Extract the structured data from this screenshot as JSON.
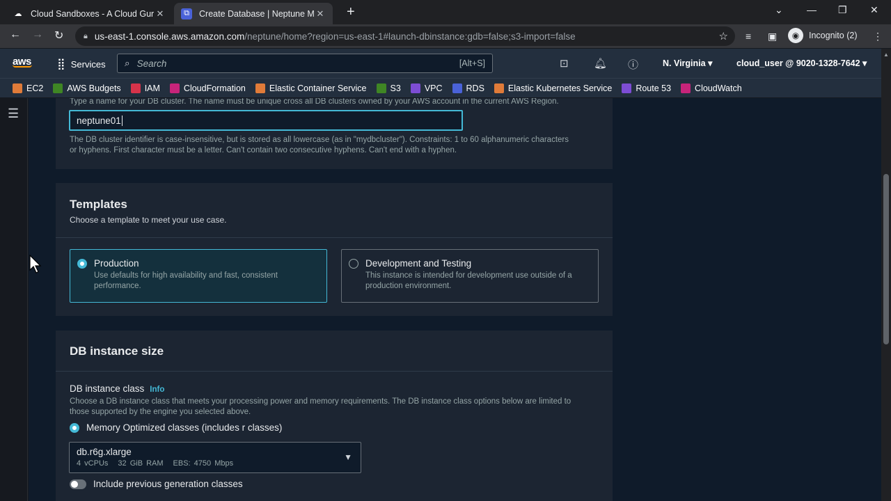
{
  "browser": {
    "tabs": [
      {
        "title": "Cloud Sandboxes - A Cloud Guru",
        "icon": "cloud-icon"
      },
      {
        "title": "Create Database | Neptune Mana",
        "icon": "neptune-icon"
      }
    ],
    "url_host": "us-east-1.console.aws.amazon.com",
    "url_path": "/neptune/home?region=us-east-1#launch-dbinstance:gdb=false;s3-import=false",
    "profile_label": "Incognito (2)"
  },
  "aws_nav": {
    "logo": "aws",
    "services_label": "Services",
    "search_placeholder": "Search",
    "search_shortcut": "[Alt+S]",
    "region": "N. Virginia",
    "account": "cloud_user @ 9020-1328-7642"
  },
  "favorites": [
    {
      "label": "EC2",
      "color": "#e07b39"
    },
    {
      "label": "AWS Budgets",
      "color": "#3f8624"
    },
    {
      "label": "IAM",
      "color": "#d6334a"
    },
    {
      "label": "CloudFormation",
      "color": "#c7247a"
    },
    {
      "label": "Elastic Container Service",
      "color": "#e07b39"
    },
    {
      "label": "S3",
      "color": "#3f8624"
    },
    {
      "label": "VPC",
      "color": "#7d4dd4"
    },
    {
      "label": "RDS",
      "color": "#4a62d8"
    },
    {
      "label": "Elastic Kubernetes Service",
      "color": "#e07b39"
    },
    {
      "label": "Route 53",
      "color": "#7d4dd4"
    },
    {
      "label": "CloudWatch",
      "color": "#c7247a"
    }
  ],
  "cluster": {
    "help_top": "Type a name for your DB cluster. The name must be unique cross all DB clusters owned by your AWS account in the current AWS Region.",
    "value": "neptune01",
    "constraint_line1": "The DB cluster identifier is case-insensitive, but is stored as all lowercase (as in \"mydbcluster\"). Constraints: 1 to 60 alphanumeric characters",
    "constraint_line2": "or hyphens. First character must be a letter. Can't contain two consecutive hyphens. Can't end with a hyphen."
  },
  "templates": {
    "title": "Templates",
    "subtitle": "Choose a template to meet your use case.",
    "options": [
      {
        "label": "Production",
        "desc1": "Use defaults for high availability and fast, consistent",
        "desc2": "performance.",
        "selected": true
      },
      {
        "label": "Development and Testing",
        "desc1": "This instance is intended for development use outside of a",
        "desc2": "production environment.",
        "selected": false
      }
    ]
  },
  "instance_size": {
    "title": "DB instance size",
    "class_label": "DB instance class",
    "info": "Info",
    "desc1": "Choose a DB instance class that meets your processing power and memory requirements. The DB instance class options below are limited to",
    "desc2": "those supported by the engine you selected above.",
    "class_option": "Memory Optimized classes (includes r classes)",
    "selected_class": "db.r6g.xlarge",
    "vcpus": "4 vCPUs",
    "ram": "32 GiB RAM",
    "ebs": "EBS: 4750 Mbps",
    "toggle_label": "Include previous generation classes"
  },
  "colors": {
    "accent": "#44b9d6",
    "aws_orange": "#ff9900",
    "panel": "#1c2532",
    "page": "#0f1b2a"
  }
}
